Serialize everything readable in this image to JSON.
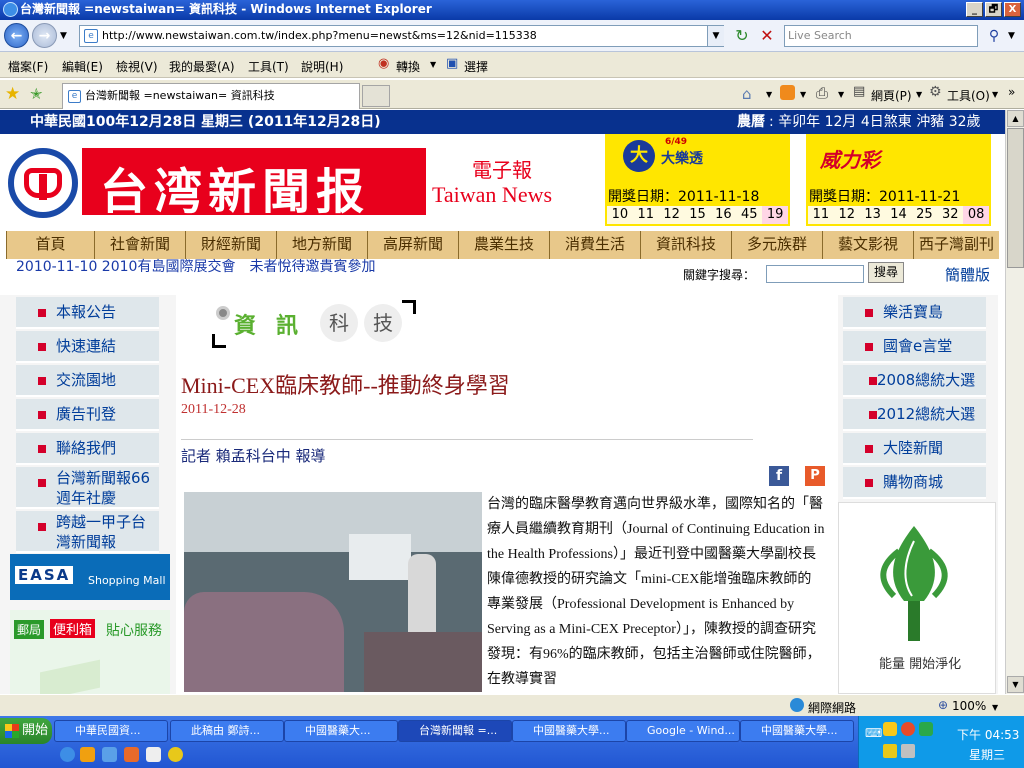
{
  "window": {
    "title": "台灣新聞報 =newstaiwan= 資訊科技 - Windows Internet Explorer",
    "buttons": [
      "_",
      "🗗",
      "X"
    ]
  },
  "addressbar": {
    "url": "http://www.newstaiwan.com.tw/index.php?menu=newst&ms=12&nid=115338",
    "search_placeholder": "Live Search"
  },
  "menu": [
    "檔案(F)",
    "編輯(E)",
    "檢視(V)",
    "我的最愛(A)",
    "工具(T)",
    "說明(H)"
  ],
  "translate": {
    "convert": "轉換",
    "select": "選擇"
  },
  "tab": {
    "label": "台灣新聞報 =newstaiwan= 資訊科技"
  },
  "cmdbar": {
    "page": "網頁(P)",
    "tools": "工具(O)"
  },
  "site": {
    "date_left": "中華民國100年12月28日 星期三 (2011年12月28日)",
    "date_right_label": "農曆",
    "date_right": ": 辛卯年 12月 4日煞東 沖豬 32歲",
    "logo_main": "台湾新聞报",
    "logo_sub1": "電子報",
    "logo_sub2": "Taiwan News",
    "lotto": {
      "name": "大樂透",
      "badge": "6/49",
      "date": "開獎日期：2011-11-18",
      "numbers": [
        "10",
        "11",
        "12",
        "15",
        "16",
        "45",
        "19"
      ]
    },
    "power": {
      "name": "威力彩",
      "date": "開獎日期：2011-11-21",
      "numbers": [
        "11",
        "12",
        "13",
        "14",
        "25",
        "32",
        "08"
      ]
    },
    "nav": [
      "首頁",
      "社會新聞",
      "財經新聞",
      "地方新聞",
      "高屏新聞",
      "農業生技",
      "消費生活",
      "資訊科技",
      "多元族群",
      "藝文影視",
      "西子灣副刊"
    ],
    "ticker": "2010-11-10 2010有島國際展交會　未者悅待邀貴賓參加",
    "keyword_label": "關鍵字搜尋：",
    "search_button": "搜尋",
    "simplified": "簡體版",
    "left_menu": [
      "本報公告",
      "快速連結",
      "交流園地",
      "廣告刊登",
      "聯絡我們",
      "台灣新聞報66週年社慶",
      "跨越一甲子台灣新聞報"
    ],
    "left_ads": {
      "easa": "EASA",
      "easa_sub": "Shopping Mall",
      "post": "郵局",
      "post_sub": "便利箱",
      "post_tail": "貼心服務"
    },
    "right_menu": [
      "樂活寶島",
      "國會e言堂",
      "2008總統大選",
      "2012總統大選",
      "大陸新聞",
      "購物商城"
    ],
    "right_ad": {
      "caption": "能量 開始淨化"
    },
    "section_title": [
      "資",
      "訊",
      "科",
      "技"
    ],
    "article": {
      "title": "Mini-CEX臨床教師--推動終身學習",
      "date": "2011-12-28",
      "byline": "記者 賴孟科台中 報導",
      "body": "台灣的臨床醫學教育邁向世界級水準，國際知名的「醫療人員繼續教育期刊（Journal of Continuing Education in the Health Professions）」最近刊登中國醫藥大學副校長陳偉德教授的研究論文「mini-CEX能增強臨床教師的專業發展（Professional Development is Enhanced by Serving as a Mini-CEX Preceptor）」，陳教授的調查研究發現：有96%的臨床教師，包括主治醫師或住院醫師，在教導實習"
    }
  },
  "status": {
    "zone": "網際網路",
    "zoom": "100%"
  },
  "taskbar": {
    "start": "開始",
    "tasks": [
      "中華民國資...",
      "此稿由 鄭詩...",
      "中國醫藥大...",
      "台灣新聞報 =...",
      "中國醫藥大學...",
      "Google - Wind...",
      "中國醫藥大學..."
    ],
    "time": "下午 04:53",
    "day": "星期三"
  },
  "colors": {
    "titlebar": "#0a3aa8",
    "nav_gold": "#e8c88a",
    "logo_red": "#e8001c",
    "lotto_yellow": "#ffe600",
    "article_title": "#8b1a1a",
    "link_blue": "#003d9a"
  }
}
